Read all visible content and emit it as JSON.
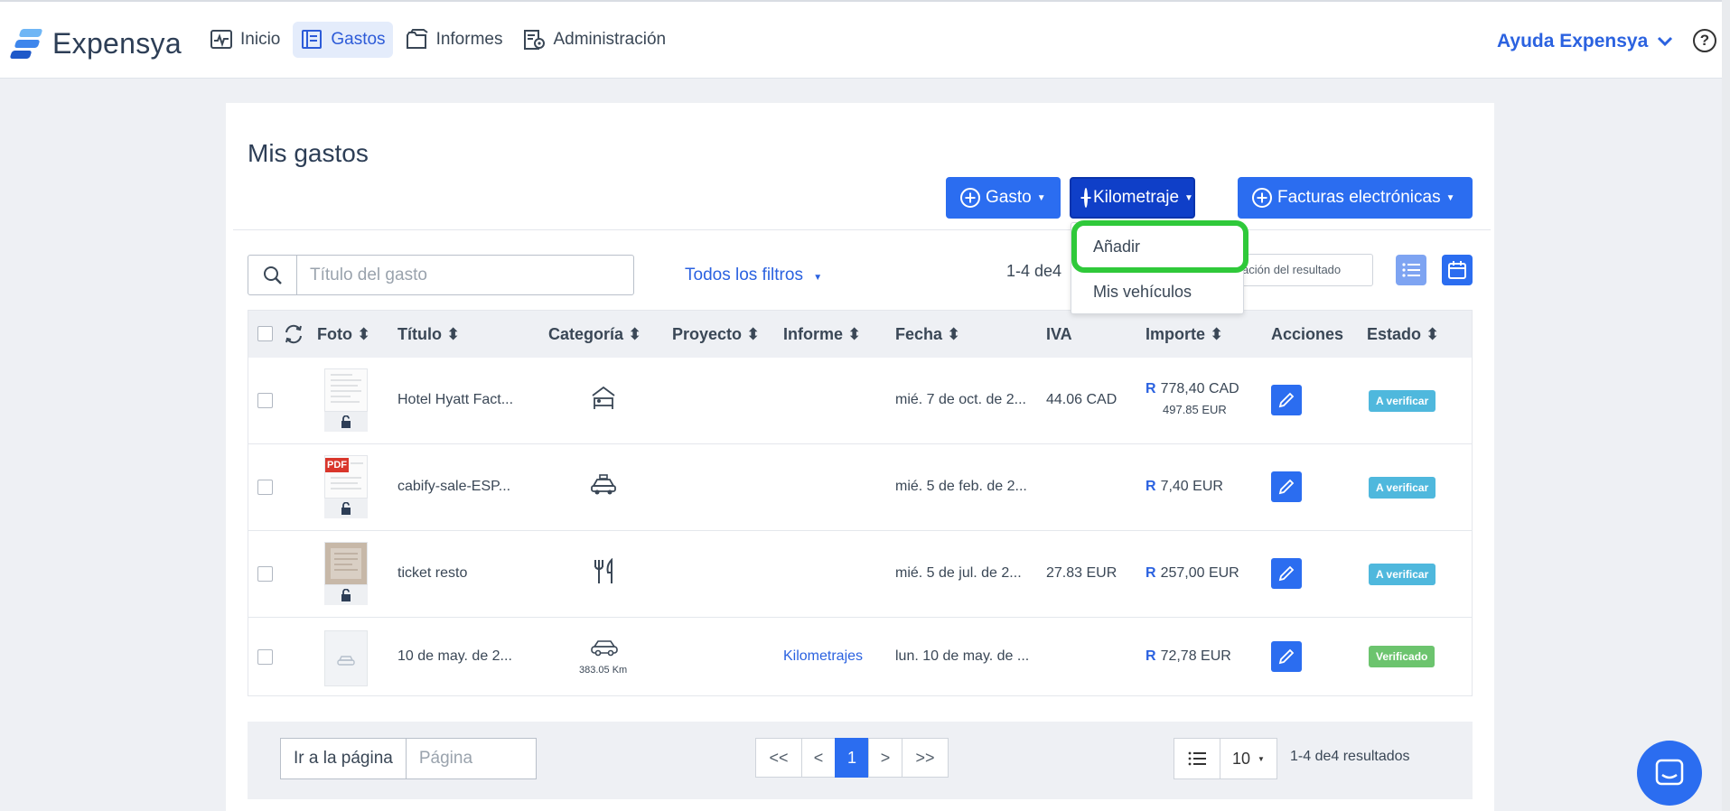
{
  "app": {
    "name": "Expensya"
  },
  "nav": [
    {
      "label": "Inicio",
      "icon": "activity-icon"
    },
    {
      "label": "Gastos",
      "icon": "receipt-icon",
      "active": true
    },
    {
      "label": "Informes",
      "icon": "folder-icon"
    },
    {
      "label": "Administración",
      "icon": "admin-settings-icon"
    }
  ],
  "help": {
    "label": "Ayuda Expensya",
    "question": "?"
  },
  "page": {
    "title": "Mis gastos"
  },
  "buttons": {
    "gasto": "Gasto",
    "kilometraje": "Kilometraje",
    "facturas": "Facturas electrónicas"
  },
  "dropdown": {
    "add": "Añadir",
    "vehicles": "Mis vehículos"
  },
  "search": {
    "placeholder": "Título del gasto"
  },
  "filters": {
    "label": "Todos los filtros"
  },
  "result_count": "1-4 de4",
  "sort": {
    "label": "ación del resultado"
  },
  "columns": {
    "foto": "Foto",
    "titulo": "Título",
    "categoria": "Categoría",
    "proyecto": "Proyecto",
    "informe": "Informe",
    "fecha": "Fecha",
    "iva": "IVA",
    "importe": "Importe",
    "acciones": "Acciones",
    "estado": "Estado"
  },
  "rows": [
    {
      "title": "Hotel Hyatt Fact...",
      "category_icon": "hotel-bed-icon",
      "category_text": "",
      "report": "",
      "date": "mié. 7 de oct. de 2...",
      "vat": "44.06 CAD",
      "amount_symbol": "R",
      "amount": "778,40 CAD",
      "amount_sub": "497.85 EUR",
      "status": "A verificar",
      "status_color": "#4fb8dd"
    },
    {
      "title": "cabify-sale-ESP...",
      "category_icon": "taxi-icon",
      "category_text": "",
      "report": "",
      "date": "mié. 5 de feb. de 2...",
      "vat": "",
      "amount_symbol": "R",
      "amount": "7,40 EUR",
      "amount_sub": "",
      "status": "A verificar",
      "status_color": "#4fb8dd"
    },
    {
      "title": "ticket resto",
      "category_icon": "restaurant-icon",
      "category_text": "",
      "report": "",
      "date": "mié. 5 de jul. de 2...",
      "vat": "27.83 EUR",
      "amount_symbol": "R",
      "amount": "257,00 EUR",
      "amount_sub": "",
      "status": "A verificar",
      "status_color": "#4fb8dd"
    },
    {
      "title": "10 de may. de 2...",
      "category_icon": "car-icon",
      "category_text": "383.05 Km",
      "report": "Kilometrajes",
      "date": "lun. 10 de may. de ...",
      "vat": "",
      "amount_symbol": "R",
      "amount": "72,78 EUR",
      "amount_sub": "",
      "status": "Verificado",
      "status_color": "#6cc46e"
    }
  ],
  "thumb": {
    "pdf": "PDF"
  },
  "pagination": {
    "goto_label": "Ir a la página",
    "page_placeholder": "Página",
    "first": "<<",
    "prev": "<",
    "current": "1",
    "next": ">",
    "last": ">>",
    "page_size": "10",
    "results": "1-4 de4 resultados"
  },
  "colors": {
    "accent": "#2b6df0",
    "dark_accent": "#0f3fc8",
    "highlight": "#2fc93a",
    "verify": "#4fb8dd",
    "verified": "#6cc46e"
  }
}
